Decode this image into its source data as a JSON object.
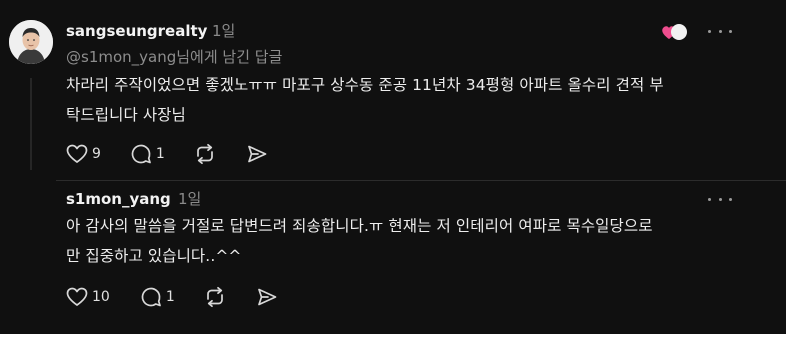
{
  "comments": [
    {
      "username": "sangseungrealty",
      "time": "1일",
      "reply_to": "@s1mon_yang님에게 남긴 답글",
      "lines": [
        "차라리 주작이었으면 좋겠노ㅠㅠ 마포구 상수동 준공 11년차 34평형 아파트 올수리 견적 부",
        "탁드립니다 사장님"
      ],
      "likes": "9",
      "replies": "1"
    },
    {
      "username": "s1mon_yang",
      "time": "1일",
      "lines": [
        "아 감사의 말씀을 거절로 답변드려 죄송합니다.ㅠ 현재는 저 인테리어 여파로 목수일당으로",
        "만 집중하고 있습니다..^^"
      ],
      "likes": "10",
      "replies": "1"
    }
  ],
  "icons": {
    "heart": "heart-icon",
    "comment": "comment-icon",
    "repost": "repost-icon",
    "share": "send-icon",
    "more": "more-dots-icon",
    "liked_toggle": "liked-heart-toggle-icon"
  },
  "colors": {
    "background": "#101010",
    "text": "#ededed",
    "muted": "#8a8a8a",
    "accent_pink": "#ee4d8e"
  }
}
